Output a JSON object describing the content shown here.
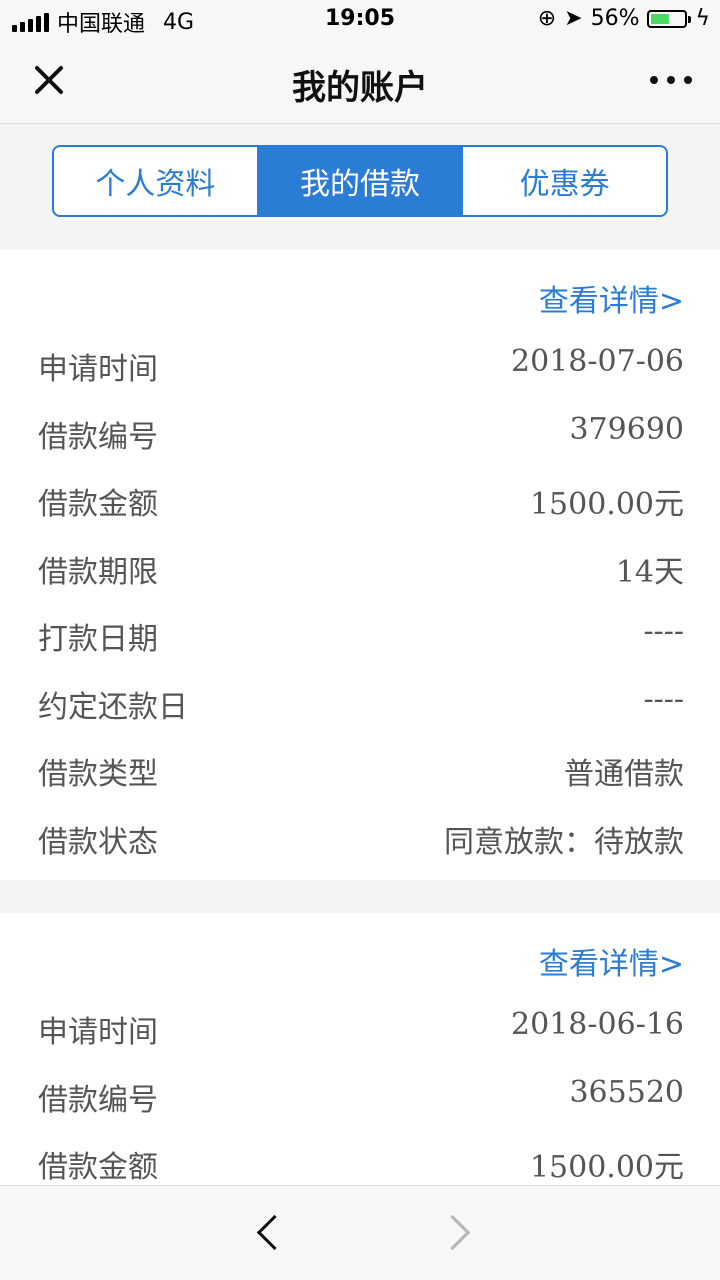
{
  "status_bar": {
    "carrier": "中国联通",
    "network": "4G",
    "time": "19:05",
    "battery": "56%",
    "battery_level": 0.56
  },
  "nav": {
    "title": "我的账户"
  },
  "tabs": [
    {
      "label": "个人资料",
      "active": false
    },
    {
      "label": "我的借款",
      "active": true
    },
    {
      "label": "优惠券",
      "active": false
    }
  ],
  "loans": [
    {
      "detail_link": "查看详情>",
      "rows": [
        {
          "label": "申请时间",
          "value": "2018-07-06"
        },
        {
          "label": "借款编号",
          "value": "379690"
        },
        {
          "label": "借款金额",
          "value": "1500.00元"
        },
        {
          "label": "借款期限",
          "value": "14天"
        },
        {
          "label": "打款日期",
          "value": "----"
        },
        {
          "label": "约定还款日",
          "value": "----"
        },
        {
          "label": "借款类型",
          "value": "普通借款"
        },
        {
          "label": "借款状态",
          "value": "同意放款：待放款"
        }
      ]
    },
    {
      "detail_link": "查看详情>",
      "rows": [
        {
          "label": "申请时间",
          "value": "2018-06-16"
        },
        {
          "label": "借款编号",
          "value": "365520"
        },
        {
          "label": "借款金额",
          "value": "1500.00元"
        }
      ]
    }
  ],
  "colors": {
    "accent": "#2a7cd5",
    "battery": "#4cd964"
  }
}
